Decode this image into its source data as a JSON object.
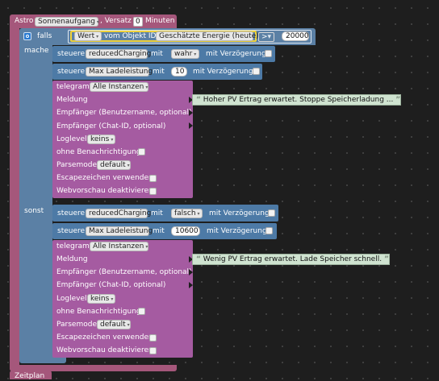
{
  "astro": {
    "label": "Astro",
    "event": "Sonnenaufgang",
    "offset_label": ", Versatz",
    "offset_value": "0",
    "unit": "Minuten"
  },
  "if_block": {
    "falls_label": "falls",
    "mache_label": "mache",
    "sonst_label": "sonst",
    "condition": {
      "wert_label": "Wert",
      "object_label": "vom Objekt ID",
      "object_name": "Geschätzte Energie (heute)",
      "operator": ">",
      "value": "20000"
    }
  },
  "then_branch": {
    "control1": {
      "label": "steuere",
      "object": "reducedCharging",
      "mit_label": "mit",
      "value": "wahr",
      "delay_label": "mit Verzögerung"
    },
    "control2": {
      "label": "steuere",
      "object": "Max Ladeleistung",
      "mit_label": "mit",
      "value": "10",
      "delay_label": "mit Verzögerung"
    },
    "telegram": {
      "label": "telegram",
      "instances": "Alle Instanzen",
      "meldung_label": "Meldung",
      "message": "Hoher PV Ertrag erwartet. Stoppe Speicherladung ...",
      "empfaenger_user_label": "Empfänger (Benutzername, optional)",
      "empfaenger_chat_label": "Empfänger (Chat-ID, optional)",
      "loglevel_label": "Loglevel",
      "loglevel_value": "keins",
      "silent_label": "ohne Benachrichtigung",
      "parsemode_label": "Parsemode",
      "parsemode_value": "default",
      "escape_label": "Escapezeichen verwenden",
      "preview_label": "Webvorschau deaktivieren"
    }
  },
  "else_branch": {
    "control1": {
      "label": "steuere",
      "object": "reducedCharging",
      "mit_label": "mit",
      "value": "falsch",
      "delay_label": "mit Verzögerung"
    },
    "control2": {
      "label": "steuere",
      "object": "Max Ladeleistung",
      "mit_label": "mit",
      "value": "10600",
      "delay_label": "mit Verzögerung"
    },
    "telegram": {
      "label": "telegram",
      "instances": "Alle Instanzen",
      "meldung_label": "Meldung",
      "message": "Wenig PV Ertrag erwartet. Lade Speicher schnell.",
      "empfaenger_user_label": "Empfänger (Benutzername, optional)",
      "empfaenger_chat_label": "Empfänger (Chat-ID, optional)",
      "loglevel_label": "Loglevel",
      "loglevel_value": "keins",
      "silent_label": "ohne Benachrichtigung",
      "parsemode_label": "Parsemode",
      "parsemode_value": "default",
      "escape_label": "Escapezeichen verwenden",
      "preview_label": "Webvorschau deaktivieren"
    }
  },
  "next_block": {
    "label": "Zeitplan"
  },
  "icons": {
    "quote_open": "“",
    "quote_close": "”",
    "gear": "gear-icon",
    "dropdown": "▾"
  },
  "colors": {
    "astro": "#a5577b",
    "logic": "#5b80a5",
    "control": "#4d7aa6",
    "telegram": "#a55ba1",
    "string": "#cfe3d0"
  }
}
